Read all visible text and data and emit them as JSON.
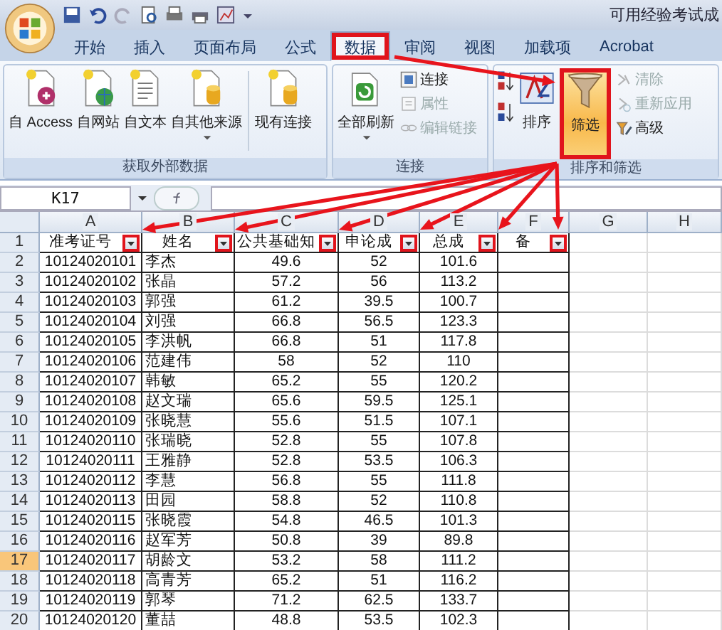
{
  "window": {
    "title": "可用经验考试成"
  },
  "tabs": [
    {
      "label": "开始",
      "selected": false,
      "highlighted": false
    },
    {
      "label": "插入",
      "selected": false,
      "highlighted": false
    },
    {
      "label": "页面布局",
      "selected": false,
      "highlighted": false
    },
    {
      "label": "公式",
      "selected": false,
      "highlighted": false
    },
    {
      "label": "数据",
      "selected": true,
      "highlighted": true
    },
    {
      "label": "审阅",
      "selected": false,
      "highlighted": false
    },
    {
      "label": "视图",
      "selected": false,
      "highlighted": false
    },
    {
      "label": "加载项",
      "selected": false,
      "highlighted": false
    },
    {
      "label": "Acrobat",
      "selected": false,
      "highlighted": false
    }
  ],
  "ribbon": {
    "groups": [
      {
        "label": "获取外部数据",
        "items": [
          {
            "kind": "large",
            "label": "自 Access",
            "dropdown": false
          },
          {
            "kind": "large",
            "label": "自网站",
            "dropdown": false
          },
          {
            "kind": "large",
            "label": "自文本",
            "dropdown": false
          },
          {
            "kind": "large",
            "label": "自其他来源",
            "dropdown": true
          },
          {
            "kind": "large",
            "label": "现有连接",
            "dropdown": false
          }
        ]
      },
      {
        "label": "连接",
        "items": [
          {
            "kind": "large",
            "label": "全部刷新",
            "dropdown": true
          },
          {
            "kind": "small",
            "label": "连接",
            "disabled": false
          },
          {
            "kind": "small",
            "label": "属性",
            "disabled": true
          },
          {
            "kind": "small",
            "label": "编辑链接",
            "disabled": true
          }
        ]
      },
      {
        "label": "排序和筛选",
        "items": [
          {
            "kind": "sortpair"
          },
          {
            "kind": "large",
            "label": "排序",
            "dropdown": false
          },
          {
            "kind": "filter",
            "label": "筛选",
            "selected": true,
            "highlighted": true
          },
          {
            "kind": "small",
            "label": "清除",
            "disabled": true
          },
          {
            "kind": "small",
            "label": "重新应用",
            "disabled": true
          },
          {
            "kind": "small",
            "label": "高级",
            "disabled": false
          }
        ]
      }
    ]
  },
  "formula_bar": {
    "name_box": "K17"
  },
  "sheet": {
    "columns": [
      "A",
      "B",
      "C",
      "D",
      "E",
      "F",
      "G",
      "H"
    ],
    "header_row": {
      "number": "1",
      "selected": false,
      "cells": [
        {
          "text": "准考证号",
          "filter": true,
          "highlighted": true
        },
        {
          "text": "姓名",
          "filter": true,
          "highlighted": true
        },
        {
          "text": "公共基础知",
          "filter": true,
          "highlighted": true
        },
        {
          "text": "申论成",
          "filter": true,
          "highlighted": true
        },
        {
          "text": "总成",
          "filter": true,
          "highlighted": true
        },
        {
          "text": "备",
          "filter": true,
          "highlighted": true
        }
      ]
    },
    "rows": [
      {
        "number": "2",
        "selected": false,
        "cells": [
          "10124020101",
          "李杰",
          "49.6",
          "52",
          "101.6"
        ]
      },
      {
        "number": "3",
        "selected": false,
        "cells": [
          "10124020102",
          "张晶",
          "57.2",
          "56",
          "113.2"
        ]
      },
      {
        "number": "4",
        "selected": false,
        "cells": [
          "10124020103",
          "郭强",
          "61.2",
          "39.5",
          "100.7"
        ]
      },
      {
        "number": "5",
        "selected": false,
        "cells": [
          "10124020104",
          "刘强",
          "66.8",
          "56.5",
          "123.3"
        ]
      },
      {
        "number": "6",
        "selected": false,
        "cells": [
          "10124020105",
          "李洪帆",
          "66.8",
          "51",
          "117.8"
        ]
      },
      {
        "number": "7",
        "selected": false,
        "cells": [
          "10124020106",
          "范建伟",
          "58",
          "52",
          "110"
        ]
      },
      {
        "number": "8",
        "selected": false,
        "cells": [
          "10124020107",
          "韩敏",
          "65.2",
          "55",
          "120.2"
        ]
      },
      {
        "number": "9",
        "selected": false,
        "cells": [
          "10124020108",
          "赵文瑞",
          "65.6",
          "59.5",
          "125.1"
        ]
      },
      {
        "number": "10",
        "selected": false,
        "cells": [
          "10124020109",
          "张晓慧",
          "55.6",
          "51.5",
          "107.1"
        ]
      },
      {
        "number": "11",
        "selected": false,
        "cells": [
          "10124020110",
          "张瑞晓",
          "52.8",
          "55",
          "107.8"
        ]
      },
      {
        "number": "12",
        "selected": false,
        "cells": [
          "10124020111",
          "王雅静",
          "52.8",
          "53.5",
          "106.3"
        ]
      },
      {
        "number": "13",
        "selected": false,
        "cells": [
          "10124020112",
          "李慧",
          "56.8",
          "55",
          "111.8"
        ]
      },
      {
        "number": "14",
        "selected": false,
        "cells": [
          "10124020113",
          "田园",
          "58.8",
          "52",
          "110.8"
        ]
      },
      {
        "number": "15",
        "selected": false,
        "cells": [
          "10124020115",
          "张晓霞",
          "54.8",
          "46.5",
          "101.3"
        ]
      },
      {
        "number": "16",
        "selected": false,
        "cells": [
          "10124020116",
          "赵军芳",
          "50.8",
          "39",
          "89.8"
        ]
      },
      {
        "number": "17",
        "selected": true,
        "cells": [
          "10124020117",
          "胡龄文",
          "53.2",
          "58",
          "111.2"
        ]
      },
      {
        "number": "18",
        "selected": false,
        "cells": [
          "10124020118",
          "高青芳",
          "65.2",
          "51",
          "116.2"
        ]
      },
      {
        "number": "19",
        "selected": false,
        "cells": [
          "10124020119",
          "郭琴",
          "71.2",
          "62.5",
          "133.7"
        ]
      },
      {
        "number": "20",
        "selected": false,
        "cells": [
          "10124020120",
          "董喆",
          "48.8",
          "53.5",
          "102.3"
        ]
      }
    ]
  }
}
